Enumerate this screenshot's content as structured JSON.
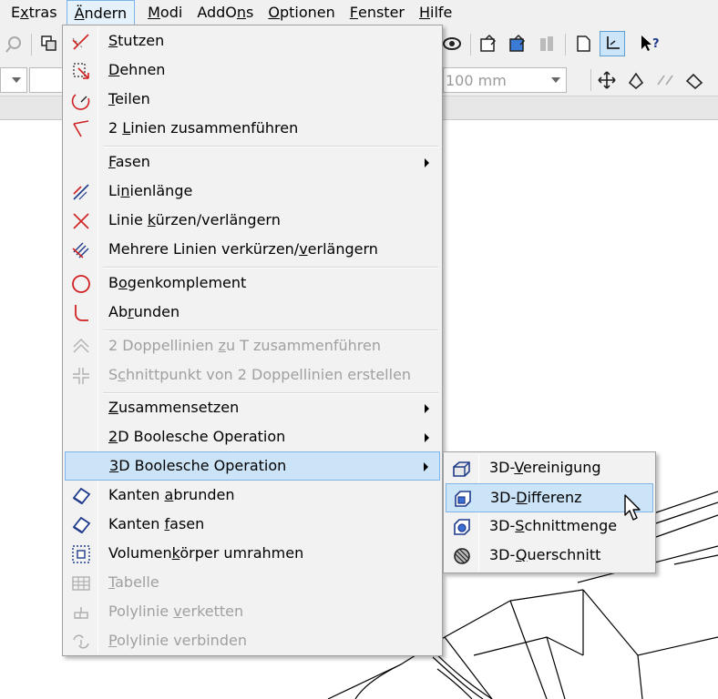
{
  "menubar": {
    "items": [
      {
        "pre": "E",
        "u": "x",
        "post": "tras"
      },
      {
        "pre": "",
        "u": "Ä",
        "post": "ndern"
      },
      {
        "pre": "",
        "u": "M",
        "post": "odi"
      },
      {
        "pre": "AddO",
        "u": "n",
        "post": "s"
      },
      {
        "pre": "",
        "u": "O",
        "post": "ptionen"
      },
      {
        "pre": "",
        "u": "F",
        "post": "enster"
      },
      {
        "pre": "",
        "u": "H",
        "post": "ilfe"
      }
    ]
  },
  "toolbar": {
    "length_combo": "100 mm"
  },
  "menu": {
    "items": [
      {
        "pre": "",
        "u": "S",
        "post": "tutzen",
        "icon": "extend-icon",
        "disabled": false,
        "submenu": false
      },
      {
        "pre": "",
        "u": "D",
        "post": "ehnen",
        "icon": "stretch-icon",
        "disabled": false,
        "submenu": false
      },
      {
        "pre": "",
        "u": "T",
        "post": "eilen",
        "icon": "split-icon",
        "disabled": false,
        "submenu": false
      },
      {
        "pre": "2 ",
        "u": "L",
        "post": "inien zusammenführen",
        "icon": "join-lines-icon",
        "disabled": false,
        "submenu": false
      },
      {
        "pre": "",
        "u": "F",
        "post": "asen",
        "icon": "",
        "disabled": false,
        "submenu": true
      },
      {
        "pre": "Li",
        "u": "n",
        "post": "ienlänge",
        "icon": "line-length-icon",
        "disabled": false,
        "submenu": false
      },
      {
        "pre": "Linie ",
        "u": "k",
        "post": "ürzen/verlängern",
        "icon": "trim-extend-icon",
        "disabled": false,
        "submenu": false
      },
      {
        "pre": "Mehrere Linien verkürzen/",
        "u": "v",
        "post": "erlängern",
        "icon": "multi-trim-icon",
        "disabled": false,
        "submenu": false
      },
      {
        "pre": "B",
        "u": "o",
        "post": "genkomplement",
        "icon": "circle-icon",
        "disabled": false,
        "submenu": false
      },
      {
        "pre": "Ab",
        "u": "r",
        "post": "unden",
        "icon": "fillet-icon",
        "disabled": false,
        "submenu": false
      },
      {
        "pre": "2 Doppellinien ",
        "u": "z",
        "post": "u T zusammenführen",
        "icon": "t-join-icon",
        "disabled": true,
        "submenu": false
      },
      {
        "pre": "S",
        "u": "c",
        "post": "hnittpunkt von 2 Doppellinien erstellen",
        "icon": "intersection-icon",
        "disabled": true,
        "submenu": false
      },
      {
        "pre": "",
        "u": "Z",
        "post": "usammensetzen",
        "icon": "",
        "disabled": false,
        "submenu": true
      },
      {
        "pre": "",
        "u": "2",
        "post": "D Boolesche Operation",
        "icon": "",
        "disabled": false,
        "submenu": true
      },
      {
        "pre": "",
        "u": "3",
        "post": "D Boolesche Operation",
        "icon": "",
        "disabled": false,
        "submenu": true,
        "highlighted": true
      },
      {
        "pre": "Kanten ",
        "u": "a",
        "post": "brunden",
        "icon": "round-edges-icon",
        "disabled": false,
        "submenu": false
      },
      {
        "pre": "Kanten ",
        "u": "f",
        "post": "asen",
        "icon": "chamfer-edges-icon",
        "disabled": false,
        "submenu": false
      },
      {
        "pre": "Volumen",
        "u": "k",
        "post": "örper umrahmen",
        "icon": "bounding-box-icon",
        "disabled": false,
        "submenu": false
      },
      {
        "pre": "",
        "u": "T",
        "post": "abelle",
        "icon": "table-icon",
        "disabled": true,
        "submenu": false
      },
      {
        "pre": "Polylinie ",
        "u": "v",
        "post": "erketten",
        "icon": "polyline-chain-icon",
        "disabled": true,
        "submenu": false
      },
      {
        "pre": "",
        "u": "P",
        "post": "olylinie verbinden",
        "icon": "polyline-connect-icon",
        "disabled": true,
        "submenu": false
      }
    ]
  },
  "submenu": {
    "items": [
      {
        "pre": "3D-",
        "u": "V",
        "post": "ereinigung",
        "icon": "union-icon"
      },
      {
        "pre": "3D-",
        "u": "D",
        "post": "ifferenz",
        "icon": "difference-icon",
        "highlighted": true
      },
      {
        "pre": "3D-",
        "u": "S",
        "post": "chnittmenge",
        "icon": "intersect-icon"
      },
      {
        "pre": "3D-",
        "u": "Q",
        "post": "uerschnitt",
        "icon": "section-icon"
      }
    ]
  },
  "colors": {
    "menu_bg": "#f2f2f2",
    "highlight_bg": "#cce4f7",
    "highlight_border": "#7eb4ea",
    "disabled_text": "#a0a0a0",
    "icon_red": "#d02020",
    "icon_blue": "#1e3a8a"
  }
}
